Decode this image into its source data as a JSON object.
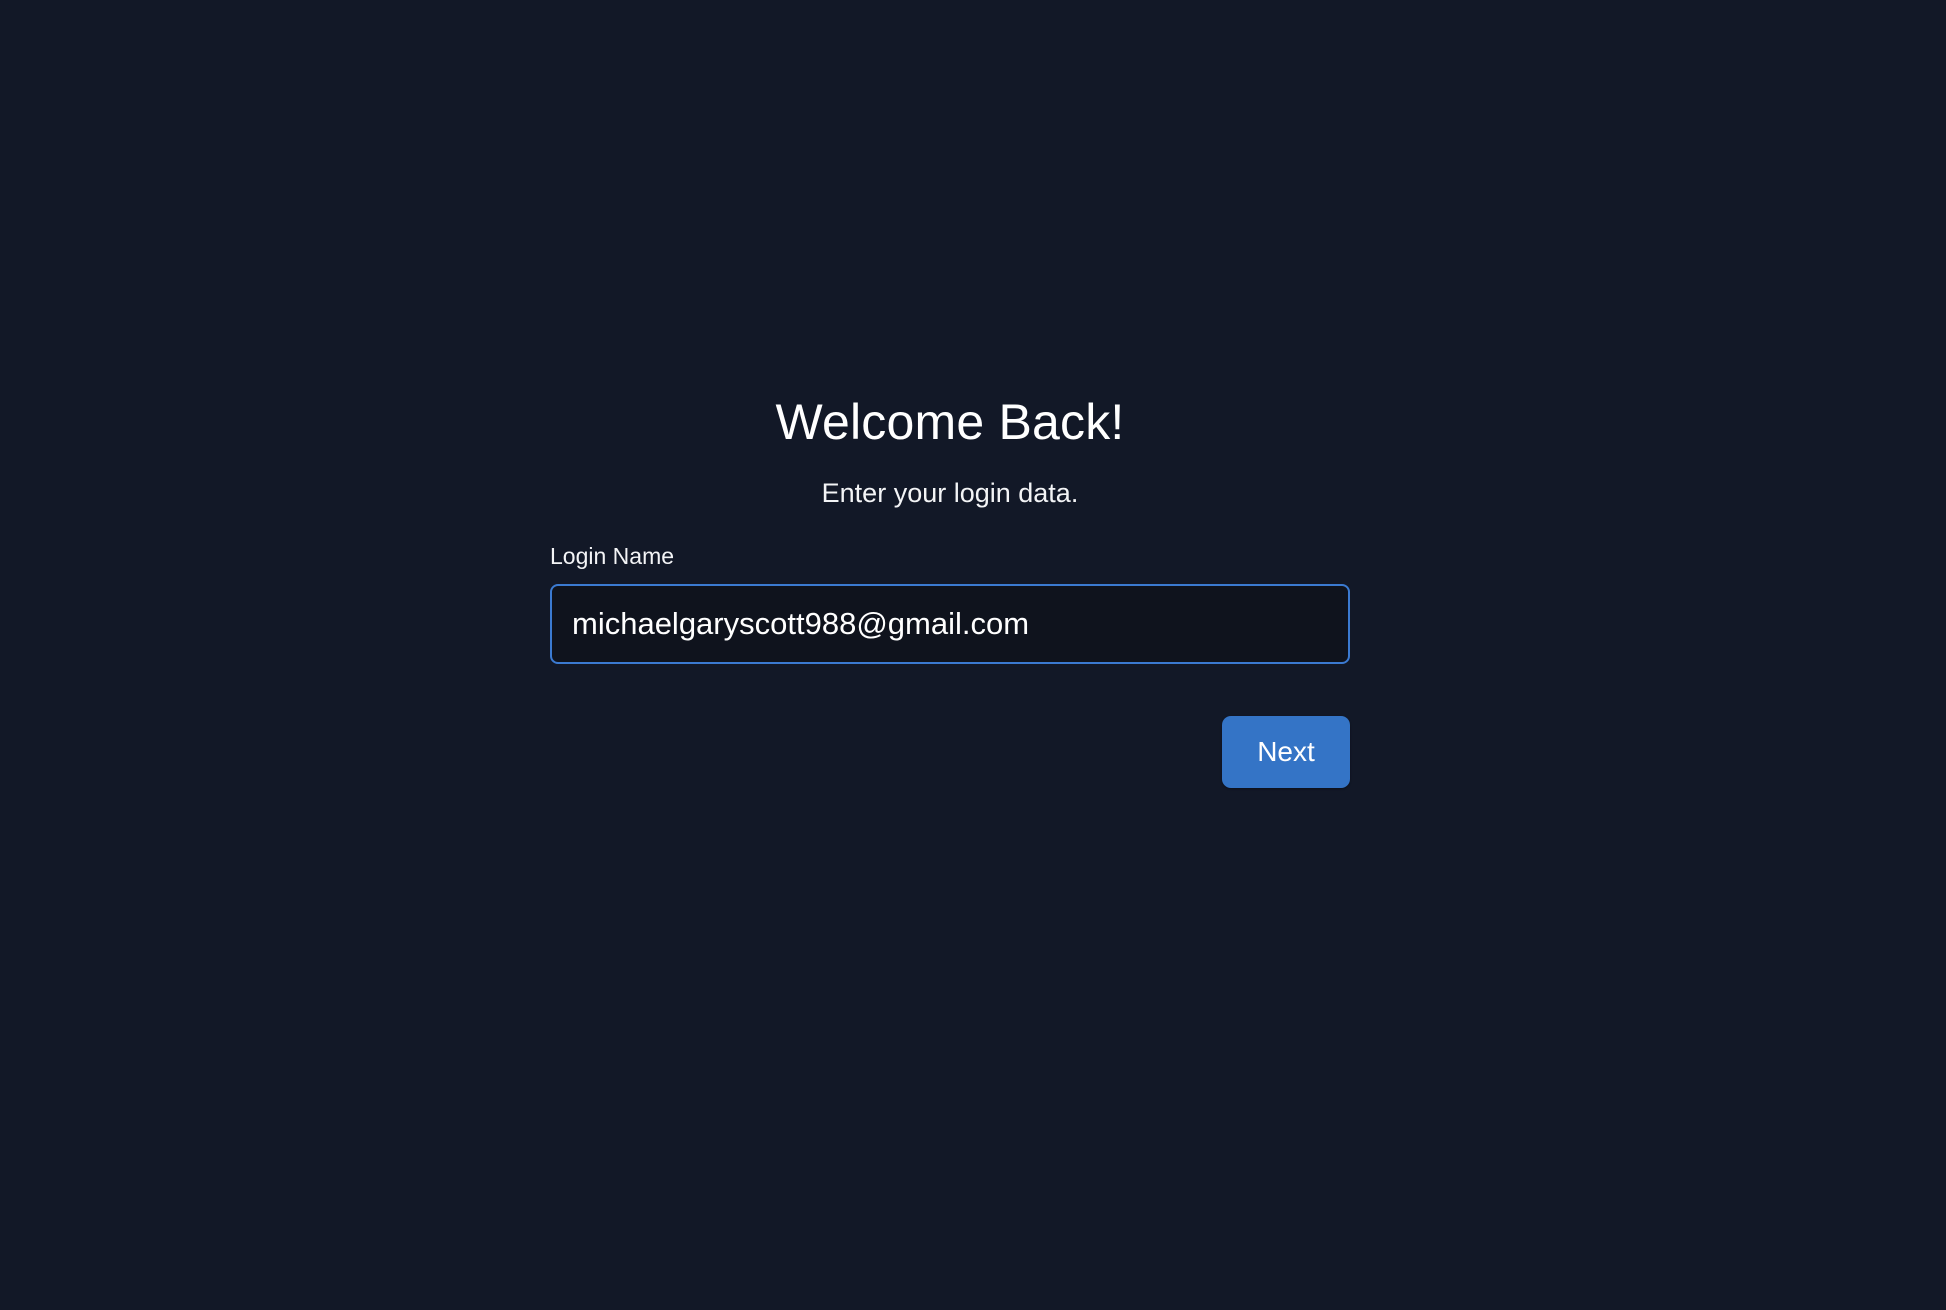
{
  "login": {
    "title": "Welcome Back!",
    "subtitle": "Enter your login data.",
    "login_name_label": "Login Name",
    "login_name_value": "michaelgaryscott988@gmail.com",
    "next_label": "Next"
  },
  "colors": {
    "background": "#121827",
    "input_border": "#3b7ad1",
    "button_bg": "#3474c6"
  }
}
